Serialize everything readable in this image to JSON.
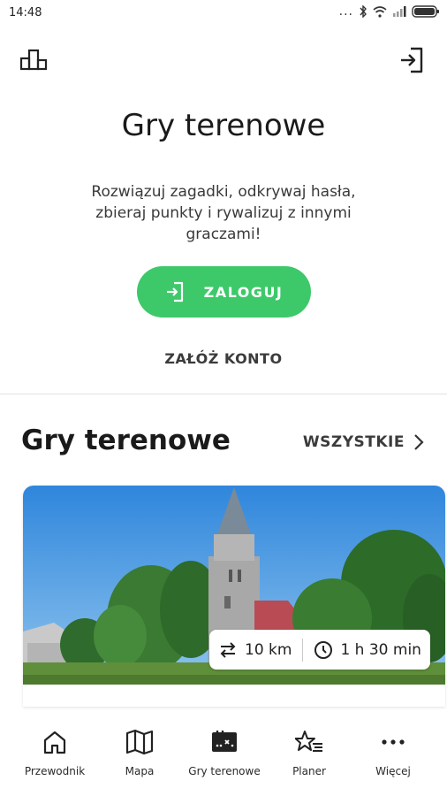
{
  "status_bar": {
    "time": "14:48",
    "dots": "..."
  },
  "header": {
    "left_icon": "leaderboard-icon",
    "right_icon": "login-icon"
  },
  "hero": {
    "title": "Gry terenowe",
    "description": "Rozwiązuj zagadki, odkrywaj hasła, zbieraj punkty i rywalizuj z innymi graczami!",
    "login_button": "ZALOGUJ",
    "register_link": "ZAŁÓŻ KONTO"
  },
  "section": {
    "title": "Gry terenowe",
    "see_all": "WSZYSTKIE"
  },
  "card": {
    "image": "church-photo",
    "distance": "10 km",
    "duration": "1 h 30 min"
  },
  "nav": {
    "items": [
      {
        "label": "Przewodnik",
        "icon": "home-icon"
      },
      {
        "label": "Mapa",
        "icon": "map-icon"
      },
      {
        "label": "Gry terenowe",
        "icon": "games-icon"
      },
      {
        "label": "Planer",
        "icon": "planner-icon"
      },
      {
        "label": "Więcej",
        "icon": "more-icon"
      }
    ]
  },
  "colors": {
    "accent": "#3dc96a",
    "text": "#1a1a1a"
  }
}
